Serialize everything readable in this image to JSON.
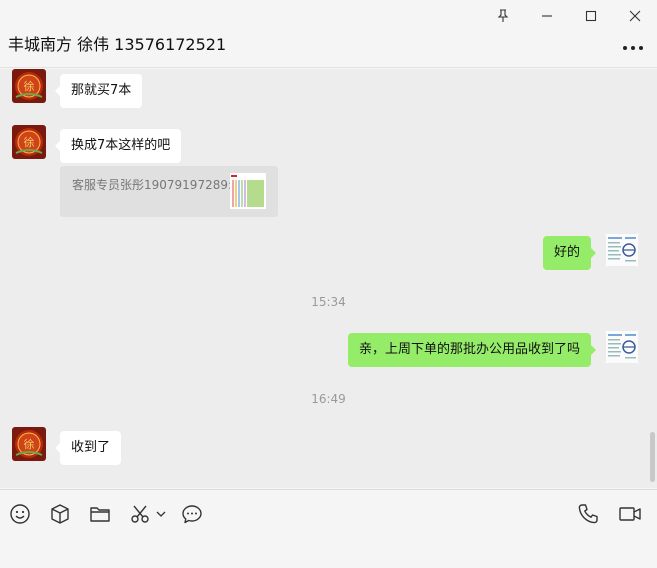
{
  "window": {
    "controls": [
      "pin-icon",
      "minimize-icon",
      "maximize-icon",
      "close-icon"
    ]
  },
  "header": {
    "title": "丰城南方 徐伟 13576172521",
    "more_icon": "more-icon"
  },
  "messages": [
    {
      "side": "left",
      "text": "那就买7本"
    },
    {
      "side": "left",
      "text": "换成7本这样的吧",
      "quote": "客服专员张彤19079197289:"
    },
    {
      "side": "right",
      "text": "好的"
    },
    {
      "type": "time",
      "text": "15:34"
    },
    {
      "side": "right",
      "text": "亲，上周下单的那批办公用品收到了吗"
    },
    {
      "type": "time",
      "text": "16:49"
    },
    {
      "side": "left",
      "text": "收到了"
    }
  ],
  "toolbar": {
    "icons": [
      "emoji-icon",
      "package-icon",
      "folder-icon",
      "scissors-icon",
      "chevron-down-icon",
      "chat-history-icon",
      "phone-icon",
      "video-icon"
    ]
  },
  "colors": {
    "my_bubble": "#95ec69",
    "their_bubble": "#ffffff",
    "chat_bg": "#ededed"
  }
}
